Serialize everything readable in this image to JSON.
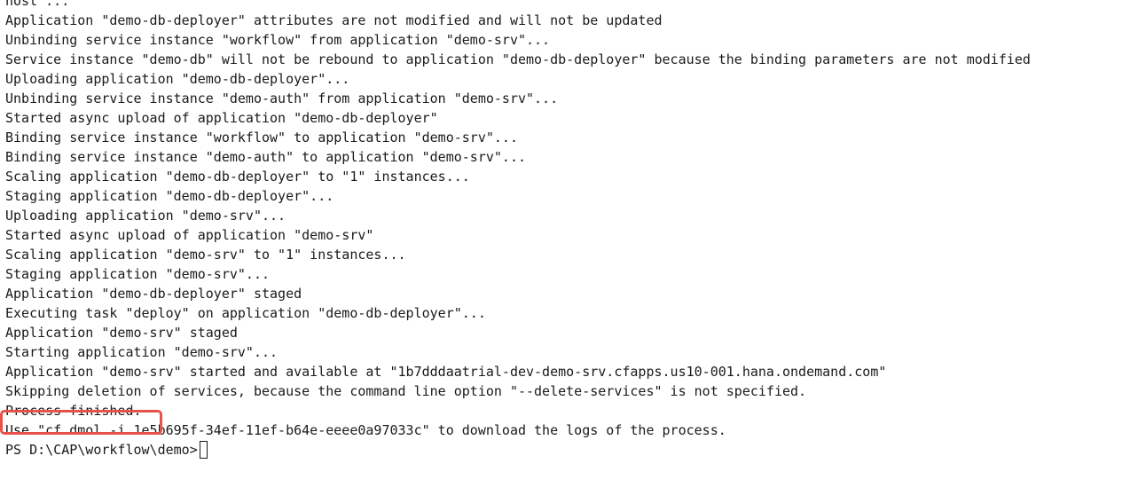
{
  "terminal": {
    "lines": [
      "host\"...",
      "Application \"demo-db-deployer\" attributes are not modified and will not be updated",
      "Unbinding service instance \"workflow\" from application \"demo-srv\"...",
      "Service instance \"demo-db\" will not be rebound to application \"demo-db-deployer\" because the binding parameters are not modified",
      "Uploading application \"demo-db-deployer\"...",
      "Unbinding service instance \"demo-auth\" from application \"demo-srv\"...",
      "Started async upload of application \"demo-db-deployer\"",
      "Binding service instance \"workflow\" to application \"demo-srv\"...",
      "Binding service instance \"demo-auth\" to application \"demo-srv\"...",
      "Scaling application \"demo-db-deployer\" to \"1\" instances...",
      "Staging application \"demo-db-deployer\"...",
      "Uploading application \"demo-srv\"...",
      "Started async upload of application \"demo-srv\"",
      "Scaling application \"demo-srv\" to \"1\" instances...",
      "Staging application \"demo-srv\"...",
      "Application \"demo-db-deployer\" staged",
      "Executing task \"deploy\" on application \"demo-db-deployer\"...",
      "Application \"demo-srv\" staged",
      "Starting application \"demo-srv\"...",
      "Application \"demo-srv\" started and available at \"1b7dddaatrial-dev-demo-srv.cfapps.us10-001.hana.ondemand.com\"",
      "Skipping deletion of services, because the command line option \"--delete-services\" is not specified.",
      "Process finished.",
      "Use \"cf dmol -i 1e5b695f-34ef-11ef-b64e-eeee0a97033c\" to download the logs of the process."
    ],
    "prompt": "PS D:\\CAP\\workflow\\demo>",
    "highlight_color": "#e8504a"
  }
}
